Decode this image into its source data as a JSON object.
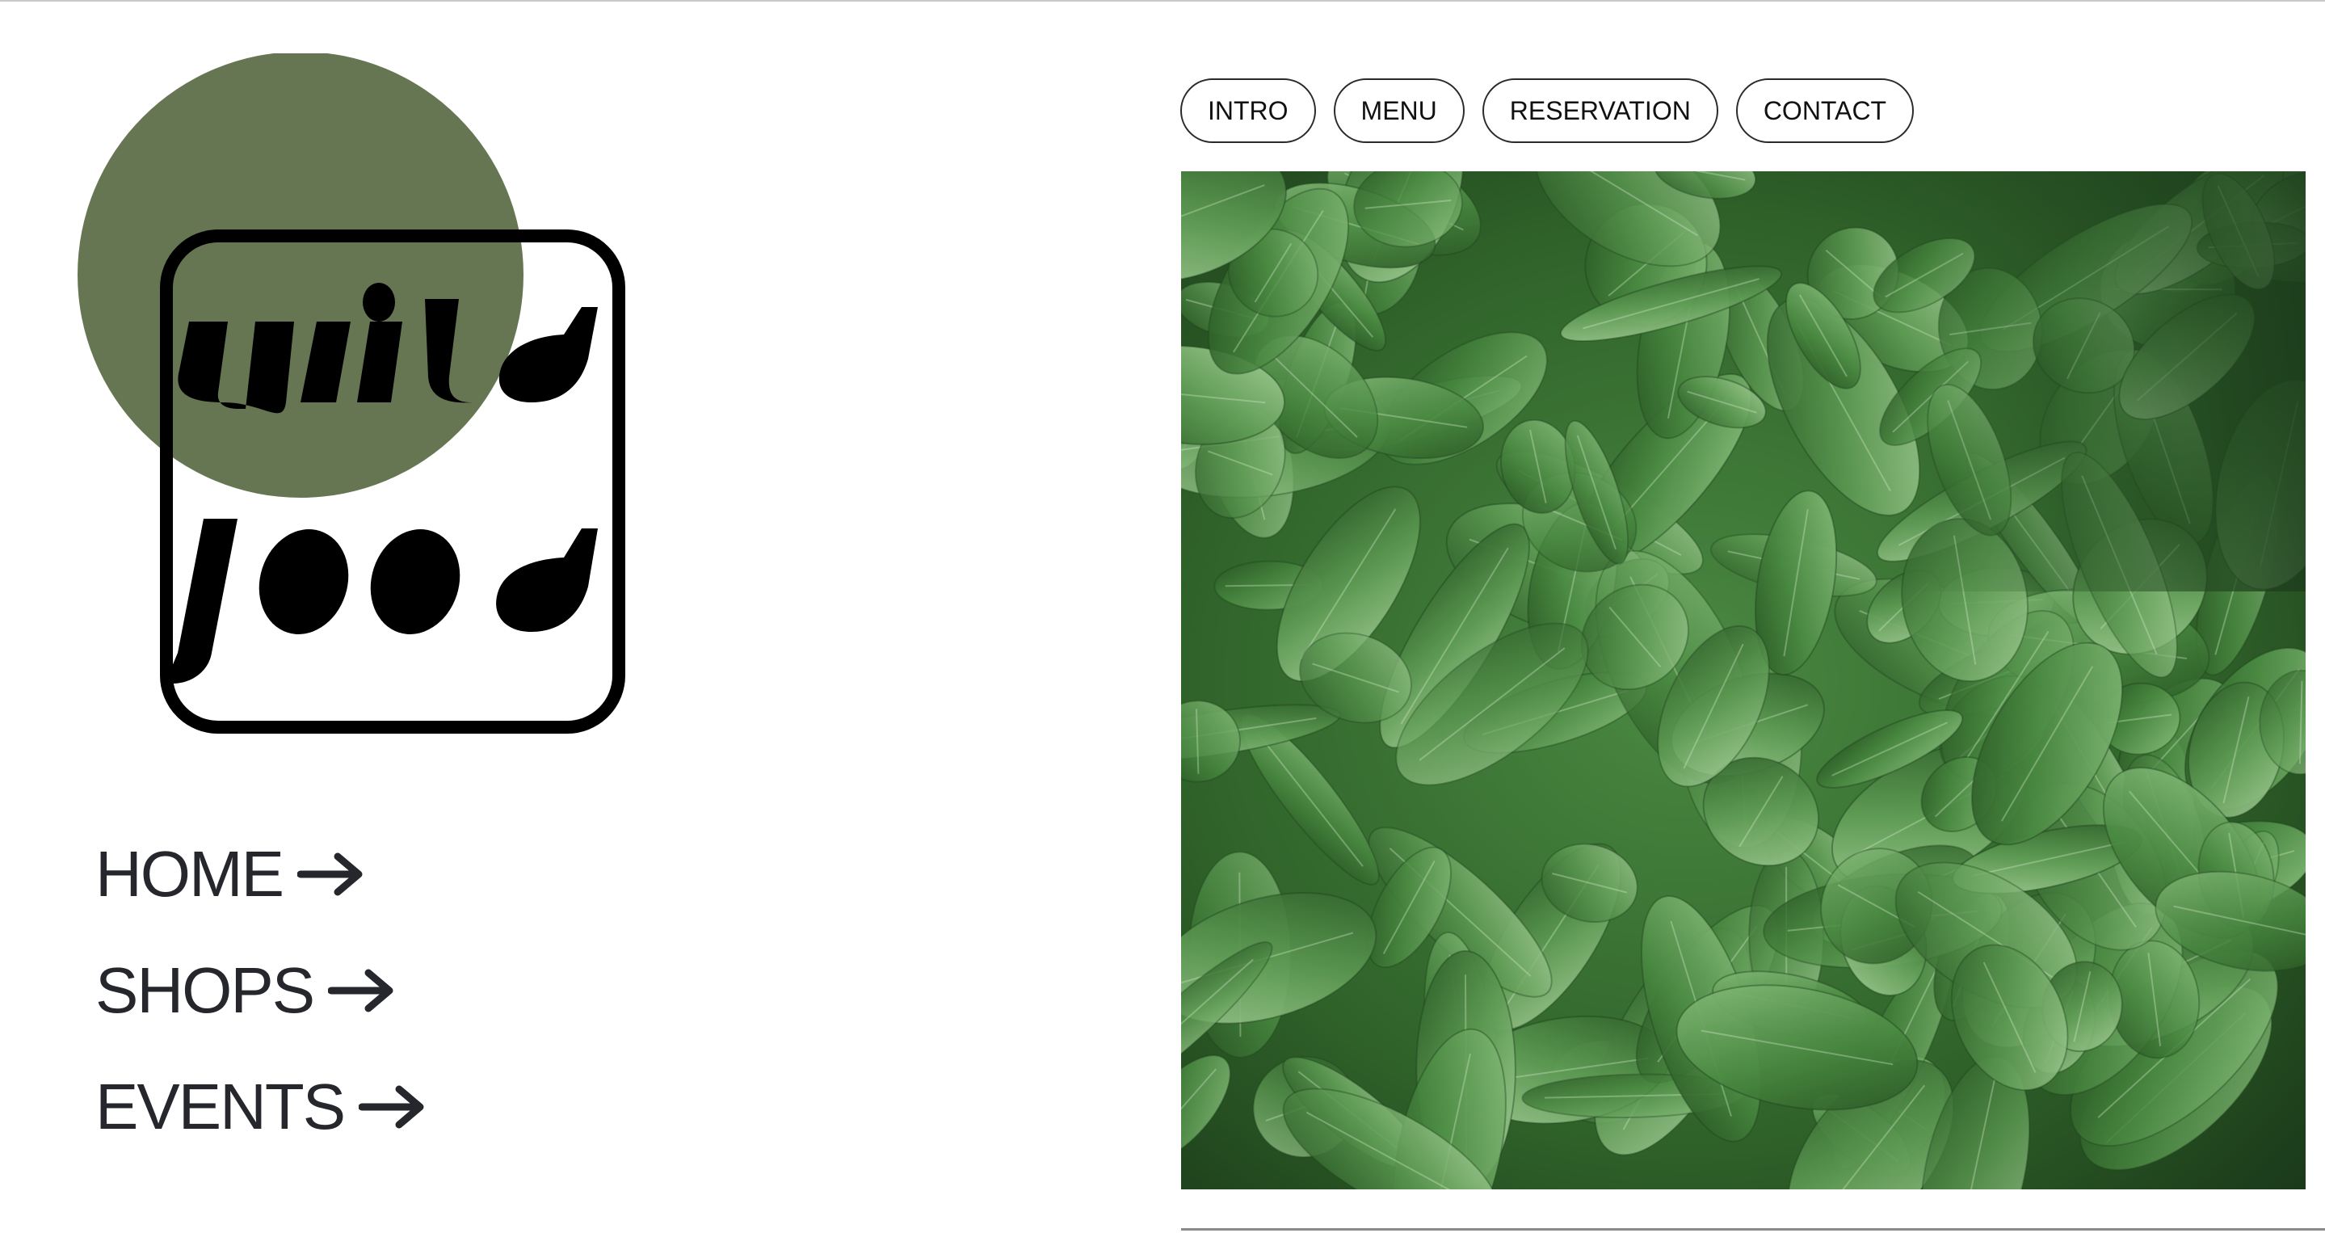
{
  "brand": {
    "logo_word_top": "wild",
    "logo_word_bottom": "food",
    "logo_circle_color": "#667653",
    "logo_ink_color": "#000000"
  },
  "left_nav": {
    "items": [
      {
        "label": "HOME",
        "icon": "arrow-right-icon"
      },
      {
        "label": "SHOPS",
        "icon": "arrow-right-icon"
      },
      {
        "label": "EVENTS",
        "icon": "arrow-right-icon"
      }
    ]
  },
  "tabs": {
    "items": [
      {
        "label": "INTRO"
      },
      {
        "label": "MENU"
      },
      {
        "label": "RESERVATION"
      },
      {
        "label": "CONTACT"
      }
    ]
  },
  "hero": {
    "subject": "spinach-leaves-photo",
    "colors": {
      "dark": "#1d3d1c",
      "mid": "#3f7a3a",
      "light": "#7fb277"
    }
  }
}
